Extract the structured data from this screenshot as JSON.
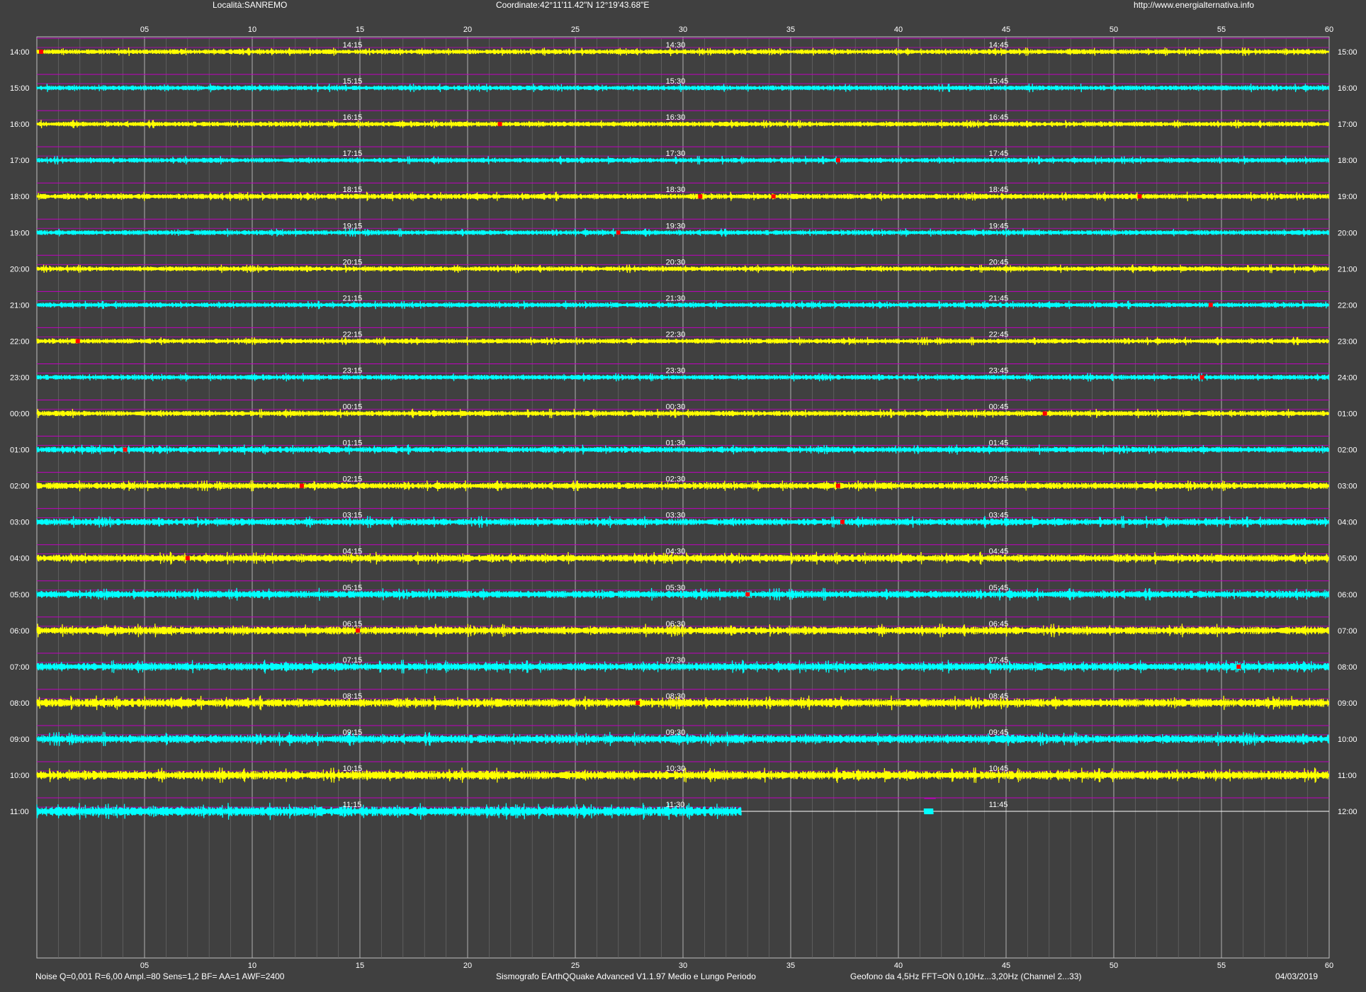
{
  "header": {
    "location": "Località:SANREMO",
    "coordinates": "Coordinate:42°11'11.42\"N  12°19'43.68\"E",
    "url": "http://www.energialternativa.info"
  },
  "footer": {
    "noise_params": "Noise Q=0,001 R=6,00 Ampl.=80 Sens=1,2 BF= AA=1 AWF=2400",
    "software": "Sismografo  EArthQQuake Advanced V1.1.97  Medio e Lungo Periodo",
    "geofono": "Geofono da 4,5Hz FFT=ON 0,10Hz...3,20Hz     (Channel 2...33)",
    "date": "04/03/2019"
  },
  "colors": {
    "background": "#404040",
    "trace_a": "#ffff00",
    "trace_b": "#00ffff",
    "guide": "#c000c0",
    "grid": "#909090",
    "event_marker": "#ff0000"
  },
  "chart_data": {
    "type": "line",
    "title": "",
    "x_unit": "minutes",
    "xlim": [
      0,
      60
    ],
    "x_major_ticks": [
      "05",
      "10",
      "15",
      "20",
      "25",
      "30",
      "35",
      "40",
      "45",
      "50",
      "55",
      "60"
    ],
    "grid": true,
    "rows": [
      {
        "start": "14:00",
        "end": "15:00",
        "q1": "14:15",
        "q2": "14:30",
        "q3": "14:45",
        "color": "yellow",
        "events": [
          0.2
        ],
        "amp": 1.0
      },
      {
        "start": "15:00",
        "end": "16:00",
        "q1": "15:15",
        "q2": "15:30",
        "q3": "15:45",
        "color": "cyan",
        "events": [],
        "amp": 1.0
      },
      {
        "start": "16:00",
        "end": "17:00",
        "q1": "16:15",
        "q2": "16:30",
        "q3": "16:45",
        "color": "yellow",
        "events": [
          21.5
        ],
        "amp": 1.0
      },
      {
        "start": "17:00",
        "end": "18:00",
        "q1": "17:15",
        "q2": "17:30",
        "q3": "17:45",
        "color": "cyan",
        "events": [
          37.2
        ],
        "amp": 1.0
      },
      {
        "start": "18:00",
        "end": "19:00",
        "q1": "18:15",
        "q2": "18:30",
        "q3": "18:45",
        "color": "yellow",
        "events": [
          30.8,
          34.2,
          51.2
        ],
        "amp": 1.1
      },
      {
        "start": "19:00",
        "end": "20:00",
        "q1": "19:15",
        "q2": "19:30",
        "q3": "19:45",
        "color": "cyan",
        "events": [
          27.0
        ],
        "amp": 1.0
      },
      {
        "start": "20:00",
        "end": "21:00",
        "q1": "20:15",
        "q2": "20:30",
        "q3": "20:45",
        "color": "yellow",
        "events": [],
        "amp": 1.0
      },
      {
        "start": "21:00",
        "end": "22:00",
        "q1": "21:15",
        "q2": "21:30",
        "q3": "21:45",
        "color": "cyan",
        "events": [
          54.5
        ],
        "amp": 1.0
      },
      {
        "start": "22:00",
        "end": "23:00",
        "q1": "22:15",
        "q2": "22:30",
        "q3": "22:45",
        "color": "yellow",
        "events": [
          1.9
        ],
        "amp": 1.0
      },
      {
        "start": "23:00",
        "end": "24:00",
        "q1": "23:15",
        "q2": "23:30",
        "q3": "23:45",
        "color": "cyan",
        "events": [
          54.1
        ],
        "amp": 1.0
      },
      {
        "start": "00:00",
        "end": "01:00",
        "q1": "00:15",
        "q2": "00:30",
        "q3": "00:45",
        "color": "yellow",
        "events": [
          46.8
        ],
        "amp": 1.1
      },
      {
        "start": "01:00",
        "end": "02:00",
        "q1": "01:15",
        "q2": "01:30",
        "q3": "01:45",
        "color": "cyan",
        "events": [
          4.1
        ],
        "amp": 1.2
      },
      {
        "start": "02:00",
        "end": "03:00",
        "q1": "02:15",
        "q2": "02:30",
        "q3": "02:45",
        "color": "yellow",
        "events": [
          12.3,
          37.2
        ],
        "amp": 1.3
      },
      {
        "start": "03:00",
        "end": "04:00",
        "q1": "03:15",
        "q2": "03:30",
        "q3": "03:45",
        "color": "cyan",
        "events": [
          37.4
        ],
        "amp": 1.4
      },
      {
        "start": "04:00",
        "end": "05:00",
        "q1": "04:15",
        "q2": "04:30",
        "q3": "04:45",
        "color": "yellow",
        "events": [
          7.0
        ],
        "amp": 1.5
      },
      {
        "start": "05:00",
        "end": "06:00",
        "q1": "05:15",
        "q2": "05:30",
        "q3": "05:45",
        "color": "cyan",
        "events": [
          33.0
        ],
        "amp": 1.5
      },
      {
        "start": "06:00",
        "end": "07:00",
        "q1": "06:15",
        "q2": "06:30",
        "q3": "06:45",
        "color": "yellow",
        "events": [
          14.9
        ],
        "amp": 1.6
      },
      {
        "start": "07:00",
        "end": "08:00",
        "q1": "07:15",
        "q2": "07:30",
        "q3": "07:45",
        "color": "cyan",
        "events": [
          55.8
        ],
        "amp": 1.6
      },
      {
        "start": "08:00",
        "end": "09:00",
        "q1": "08:15",
        "q2": "08:30",
        "q3": "08:45",
        "color": "yellow",
        "events": [
          27.9
        ],
        "amp": 1.7
      },
      {
        "start": "09:00",
        "end": "10:00",
        "q1": "09:15",
        "q2": "09:30",
        "q3": "09:45",
        "color": "cyan",
        "events": [],
        "amp": 1.7
      },
      {
        "start": "10:00",
        "end": "11:00",
        "q1": "10:15",
        "q2": "10:30",
        "q3": "10:45",
        "color": "yellow",
        "events": [],
        "amp": 1.8
      },
      {
        "start": "11:00",
        "end": "12:00",
        "q1": "11:15",
        "q2": "11:30",
        "q3": "11:45",
        "color": "cyan",
        "events": [],
        "amp": 2.0,
        "data_end": 32.7,
        "burst": [
          41.2,
          41.6
        ]
      }
    ]
  }
}
